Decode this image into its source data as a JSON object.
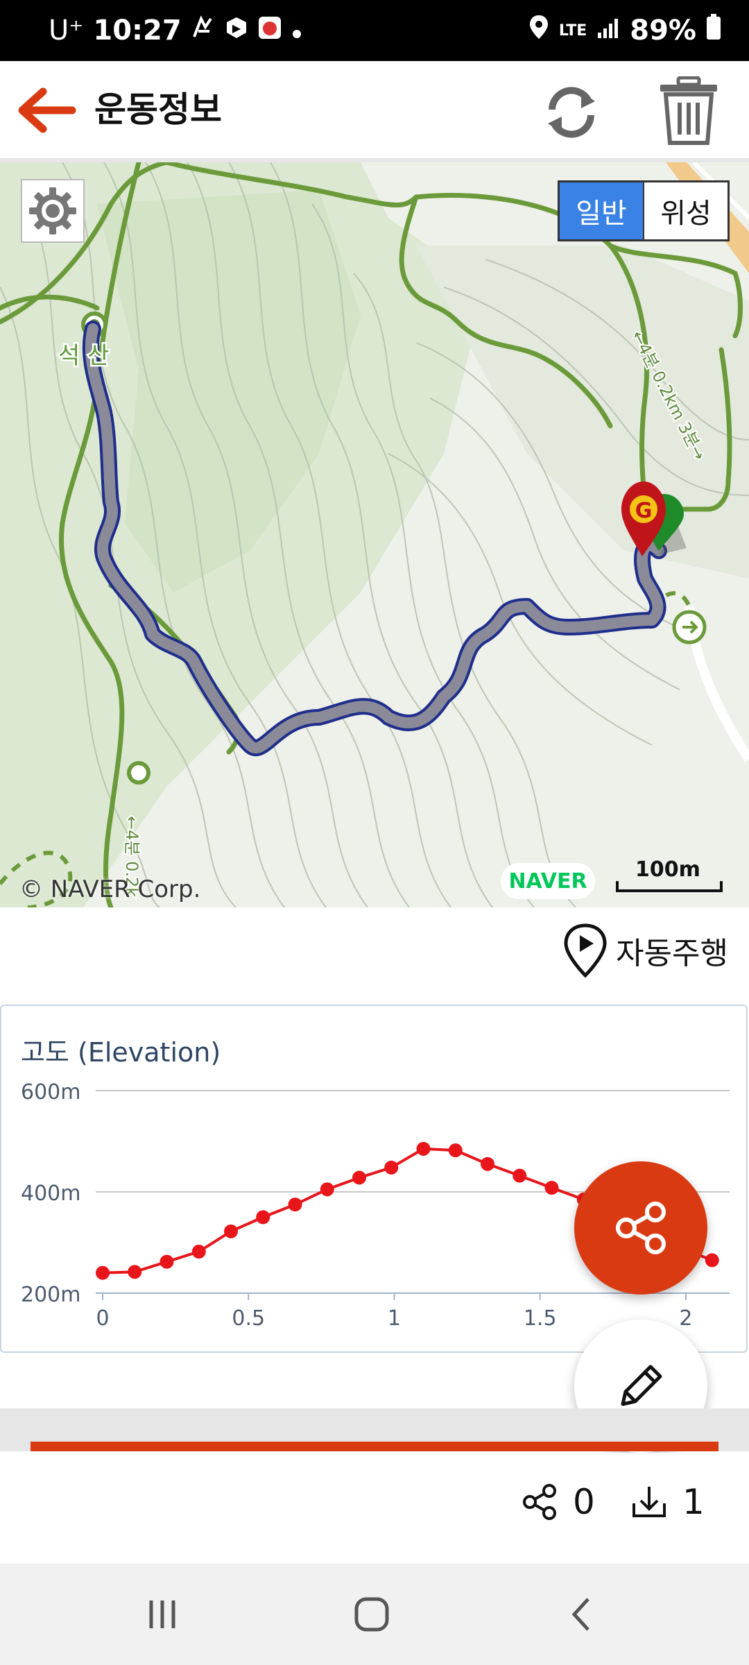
{
  "status_bar": {
    "carrier": "U⁺",
    "time": "10:27",
    "network": "LTE",
    "battery": "89%"
  },
  "app_bar": {
    "title": "운동정보"
  },
  "map": {
    "map_type_options": [
      "일반",
      "위성"
    ],
    "selected_map_type": "일반",
    "place_label": "석 산",
    "trail_label_right": "←4분 0.2km 3분→",
    "trail_label_bottom": "←4분 0.2k",
    "copyright": "© NAVER Corp.",
    "provider_logo": "NAVER",
    "scale": "100m",
    "goal_marker": "G",
    "colors": {
      "track": "#8a8a99",
      "track_outline": "#1f2e8c",
      "trail": "#6b9a3a",
      "goal": "#c0141b"
    }
  },
  "autoplay": {
    "label": "자동주행"
  },
  "chart_data": {
    "type": "line",
    "title": "고도 (Elevation)",
    "xlabel": "",
    "ylabel": "",
    "x_ticks": [
      "0",
      "0.5",
      "1",
      "1.5",
      "2"
    ],
    "y_ticks": [
      "600m",
      "400m",
      "200m"
    ],
    "xlim": [
      0,
      2.15
    ],
    "ylim": [
      200,
      600
    ],
    "grid": true,
    "series": [
      {
        "color": "#e8151b",
        "x": [
          0,
          0.11,
          0.22,
          0.33,
          0.44,
          0.55,
          0.66,
          0.77,
          0.88,
          0.99,
          1.1,
          1.21,
          1.32,
          1.43,
          1.54,
          1.65,
          1.76,
          1.87,
          1.98,
          2.09
        ],
        "y": [
          240,
          242,
          262,
          282,
          322,
          350,
          375,
          405,
          428,
          448,
          485,
          482,
          455,
          432,
          408,
          385,
          360,
          320,
          290,
          265
        ]
      }
    ]
  },
  "stats": {
    "shares": "0",
    "downloads": "1"
  }
}
